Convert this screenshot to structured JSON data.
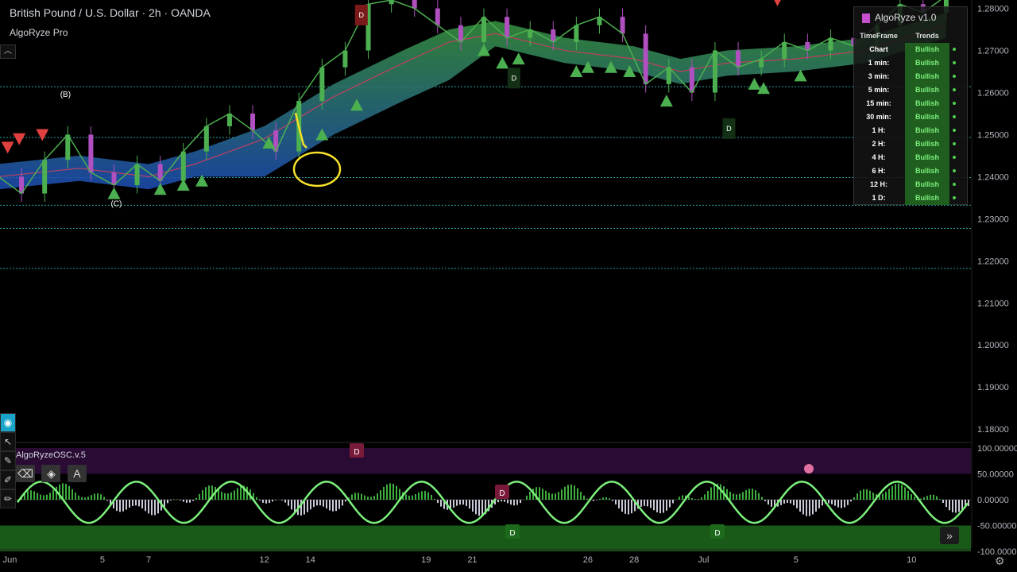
{
  "header": {
    "symbol_title": "British Pound / U.S. Dollar · 2h · OANDA",
    "indicator": "AlgoRyze Pro",
    "collapse_icon": "chevron-up-icon"
  },
  "oscillator": {
    "label": "AlgoRyzeOSC.v.5"
  },
  "chart_data": [
    {
      "type": "line",
      "subtype": "candlestick",
      "title": "British Pound / U.S. Dollar · 2h · OANDA",
      "xlabel": "",
      "ylabel": "",
      "ylim": [
        1.177,
        1.282
      ],
      "y_ticks": [
        "1.28000",
        "1.27000",
        "1.26000",
        "1.25000",
        "1.24000",
        "1.23000",
        "1.22000",
        "1.21000",
        "1.20000",
        "1.19000",
        "1.18000"
      ],
      "y_tick_values": [
        1.28,
        1.27,
        1.26,
        1.25,
        1.24,
        1.23,
        1.22,
        1.21,
        1.2,
        1.19,
        1.18
      ],
      "x_ticks": [
        "Jun",
        "5",
        "7",
        "12",
        "14",
        "19",
        "21",
        "26",
        "28",
        "Jul",
        "5",
        "10"
      ],
      "x_tick_values": [
        1,
        5,
        7,
        12,
        14,
        19,
        21,
        26,
        28,
        31,
        35,
        40
      ],
      "xlim": [
        0.5,
        42.5
      ],
      "series": [
        {
          "x": [
            0.5,
            1.5,
            2.5,
            3.5,
            4.5,
            5.5,
            6.5,
            7.5,
            8.5,
            9.5,
            10.5,
            11.5,
            12.5,
            13.5,
            14.5,
            15.5,
            16.5,
            17.5,
            18.5,
            19.5,
            20.5,
            21.5,
            22.5,
            23.5,
            24.5,
            25.5,
            26.5,
            27.5,
            28.5,
            29.5,
            30.5,
            31.5,
            32.5,
            33.5,
            34.5,
            35.5,
            36.5,
            37.5,
            38.5,
            39.5,
            40.5,
            41.5
          ],
          "y": [
            1.24,
            1.236,
            1.244,
            1.25,
            1.241,
            1.238,
            1.243,
            1.239,
            1.246,
            1.252,
            1.255,
            1.251,
            1.246,
            1.258,
            1.266,
            1.27,
            1.281,
            1.282,
            1.28,
            1.276,
            1.272,
            1.278,
            1.273,
            1.275,
            1.272,
            1.276,
            1.278,
            1.274,
            1.262,
            1.266,
            1.26,
            1.27,
            1.266,
            1.268,
            1.272,
            1.27,
            1.273,
            1.271,
            1.276,
            1.281,
            1.279,
            1.283
          ]
        },
        {
          "x": [
            0.5,
            4,
            7,
            9,
            12,
            15,
            18,
            20,
            22,
            25,
            28,
            30,
            32,
            35,
            38,
            41.5
          ],
          "y": [
            1.24,
            1.242,
            1.24,
            1.243,
            1.249,
            1.259,
            1.267,
            1.272,
            1.274,
            1.27,
            1.268,
            1.265,
            1.267,
            1.268,
            1.27,
            1.276
          ]
        }
      ],
      "horizontal_levels": [
        1.2493,
        1.2398,
        1.2332,
        1.2277,
        1.2182,
        1.2614
      ],
      "annotations": [
        "(B)",
        "(C)",
        "D",
        "D",
        "D"
      ],
      "colors": {
        "bull": "#4caf50",
        "bear": "#e04040",
        "band_top": "#3a9a3a",
        "band_bottom": "#1e4fb8",
        "level": "#2aa1a1"
      }
    },
    {
      "type": "bar",
      "title": "AlgoRyzeOSC.v.5",
      "ylim": [
        -100,
        100
      ],
      "y_ticks": [
        "100.00000",
        "50.00000",
        "0.00000",
        "-50.00000",
        "-100.00000"
      ],
      "y_tick_values": [
        100,
        50,
        0,
        -50,
        -100
      ],
      "annotations": [
        "D",
        "D",
        "D",
        "D"
      ]
    }
  ],
  "panel": {
    "title": "AlgoRyze v1.0",
    "col_timeframe": "TimeFrame",
    "col_trends": "Trends",
    "rows": [
      {
        "tf": "Chart",
        "trend": "Bullish"
      },
      {
        "tf": "1 min:",
        "trend": "Bullish"
      },
      {
        "tf": "3 min:",
        "trend": "Bullish"
      },
      {
        "tf": "5 min:",
        "trend": "Bullish"
      },
      {
        "tf": "15 min:",
        "trend": "Bullish"
      },
      {
        "tf": "30 min:",
        "trend": "Bullish"
      },
      {
        "tf": "1 H:",
        "trend": "Bullish"
      },
      {
        "tf": "2 H:",
        "trend": "Bullish"
      },
      {
        "tf": "4 H:",
        "trend": "Bullish"
      },
      {
        "tf": "6 H:",
        "trend": "Bullish"
      },
      {
        "tf": "12 H:",
        "trend": "Bullish"
      },
      {
        "tf": "1 D:",
        "trend": "Bullish"
      }
    ]
  },
  "toolbar_icons": [
    "eye-icon",
    "cursor-icon",
    "pencil-icon",
    "eraser-icon",
    "text-icon"
  ],
  "nav": {
    "scroll_right": "»"
  },
  "settings_icon": "gear-icon"
}
